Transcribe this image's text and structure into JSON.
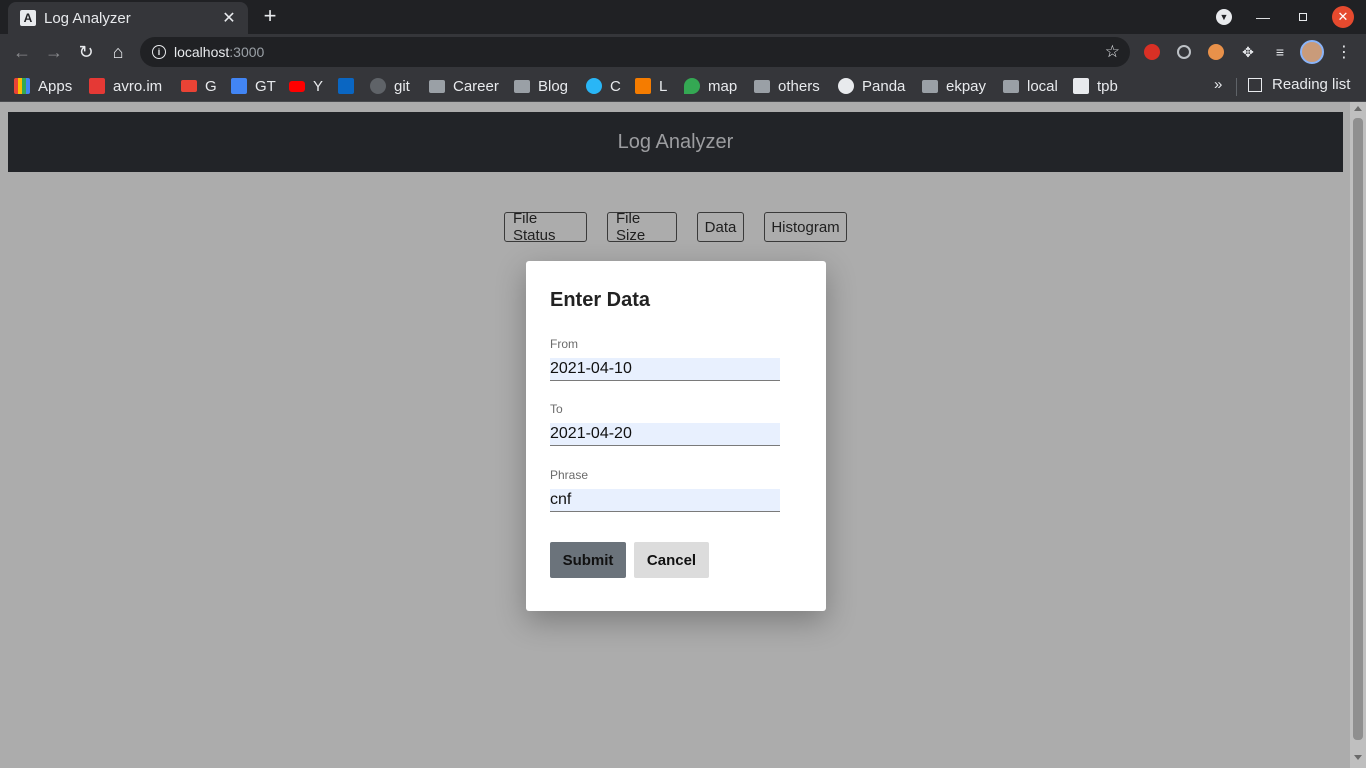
{
  "browser": {
    "tab_title": "Log Analyzer",
    "tab_favicon": "A",
    "url_host": "localhost",
    "url_port": ":3000",
    "bookmarks": [
      "Apps",
      "avro.im",
      "G",
      "GT",
      "Y",
      "",
      "git",
      "Career",
      "Blog",
      "C",
      "L",
      "map",
      "others",
      "Panda",
      "ekpay",
      "local",
      "tpb"
    ],
    "more_bookmarks": "»",
    "reading_list": "Reading list"
  },
  "app": {
    "title": "Log Analyzer",
    "nav_buttons": [
      "File Status",
      "File Size",
      "Data",
      "Histogram"
    ]
  },
  "modal": {
    "title": "Enter Data",
    "fields": [
      {
        "label": "From",
        "value": "2021-04-10"
      },
      {
        "label": "To",
        "value": "2021-04-20"
      },
      {
        "label": "Phrase",
        "value": "cnf"
      }
    ],
    "submit_label": "Submit",
    "cancel_label": "Cancel"
  },
  "colors": {
    "header_bg": "#222428",
    "overlay_bg": "#acacac",
    "submit_bg": "#6b737b",
    "cancel_bg": "#dcdcdc",
    "input_bg": "#e8f0fe"
  }
}
